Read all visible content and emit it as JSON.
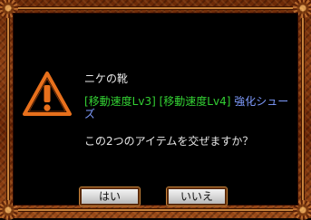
{
  "dialog": {
    "item_name": "ニケの靴",
    "item_tags": [
      "[移動速度Lv3]",
      "[移動速度Lv4]"
    ],
    "item_type": "強化シューズ",
    "question": "この2つのアイテムを交ぜますか？",
    "icon": "warning-triangle-icon",
    "colors": {
      "tag_green": "#33d033",
      "type_blue": "#7f9cff",
      "warning_orange": "#e8701c"
    }
  },
  "buttons": {
    "yes_label": "はい",
    "no_label": "いいえ"
  }
}
